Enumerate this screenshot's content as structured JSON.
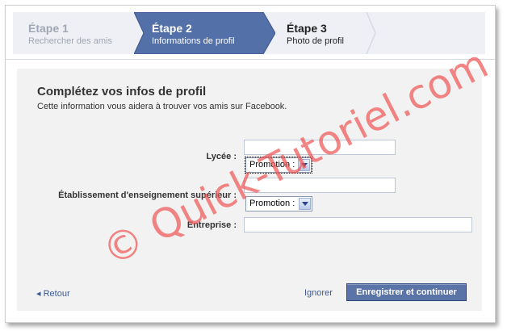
{
  "steps": [
    {
      "number": "Étape 1",
      "label": "Rechercher des amis"
    },
    {
      "number": "Étape 2",
      "label": "Informations de profil"
    },
    {
      "number": "Étape 3",
      "label": "Photo de profil"
    }
  ],
  "form": {
    "title": "Complétez vos infos de profil",
    "description": "Cette information vous aidera à trouver vos amis sur Facebook.",
    "lycee_label": "Lycée :",
    "lycee_value": "",
    "lycee_promo": "Promotion :",
    "higher_label": "Établissement d'enseignement supérieur :",
    "higher_value": "",
    "higher_promo": "Promotion :",
    "company_label": "Entreprise :",
    "company_value": ""
  },
  "footer": {
    "back_label": "Retour",
    "skip_label": "Ignorer",
    "save_label": "Enregistrer et continuer"
  },
  "watermark": "© Quick-Tutoriel.com",
  "colors": {
    "active_step": "#5470a8",
    "link": "#3b5998",
    "button": "#5b74a8",
    "watermark": "#ef5656"
  }
}
